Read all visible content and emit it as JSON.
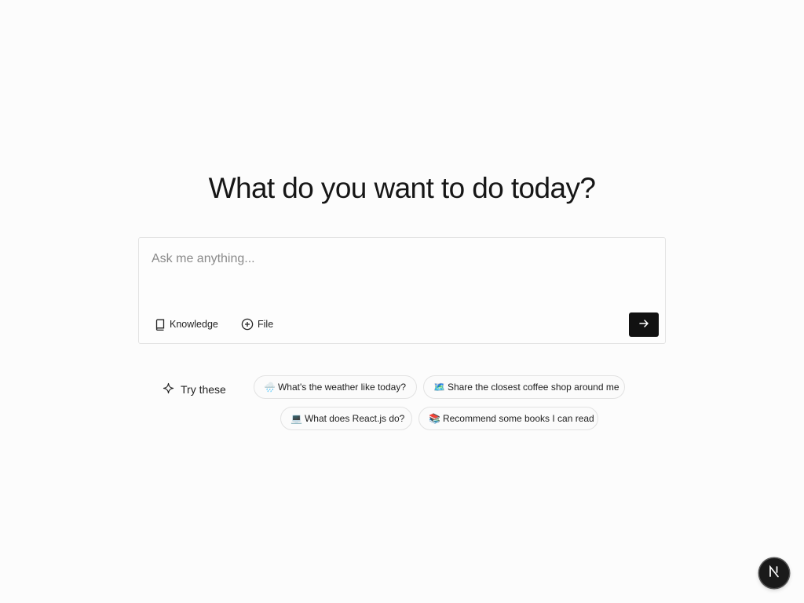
{
  "headline": "What do you want to do today?",
  "composer": {
    "placeholder": "Ask me anything...",
    "knowledge_label": "Knowledge",
    "file_label": "File"
  },
  "suggestions": {
    "label": "Try these",
    "items": [
      {
        "emoji": "🌧️",
        "text": "What's the weather like today?"
      },
      {
        "emoji": "🗺️",
        "text": "Share the closest coffee shop around me"
      },
      {
        "emoji": "💻",
        "text": "What does React.js do?"
      },
      {
        "emoji": "📚",
        "text": "Recommend some books I can read"
      }
    ]
  },
  "badge": {
    "letter": "N",
    "icon": "nextjs-logo-icon"
  },
  "colors": {
    "send_button": "#111111",
    "background": "#fcfcfc"
  }
}
